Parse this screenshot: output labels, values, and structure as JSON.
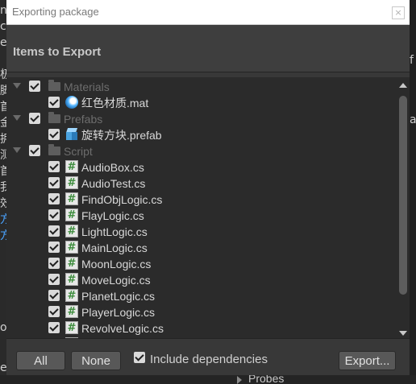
{
  "window": {
    "title": "Exporting package",
    "close_label": "×"
  },
  "header": {
    "title": "Items to Export"
  },
  "tree": {
    "folders": [
      {
        "label": "Materials",
        "expanded": true
      },
      {
        "label": "Prefabs",
        "expanded": true
      },
      {
        "label": "Script",
        "expanded": true
      }
    ],
    "material_file": "红色材质.mat",
    "prefab_file": "旋转方块.prefab",
    "scripts": [
      "AudioBox.cs",
      "AudioTest.cs",
      "FindObjLogic.cs",
      "FlayLogic.cs",
      "LightLogic.cs",
      "MainLogic.cs",
      "MoonLogic.cs",
      "MoveLogic.cs",
      "PlanetLogic.cs",
      "PlayerLogic.cs",
      "RevolveLogic.cs"
    ],
    "script_icon_glyph": "#"
  },
  "footer": {
    "all_label": "All",
    "none_label": "None",
    "include_dependencies_label": "Include dependencies",
    "include_dependencies_checked": true,
    "export_label": "Export..."
  },
  "background": {
    "bottom_panel_label": "Probes"
  },
  "colors": {
    "accent": "#4aa3ff",
    "dialog_bg": "#383838",
    "tree_bg": "#2b2b2b"
  }
}
